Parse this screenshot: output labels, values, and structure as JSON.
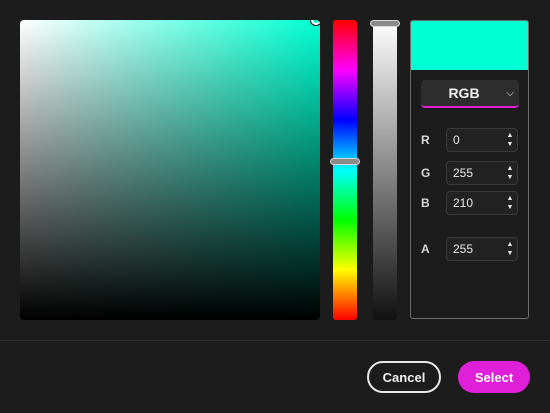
{
  "color": {
    "hue_hex": "#00ffd2",
    "preview_hex": "#00ffd2",
    "hue_level": 0.47,
    "alpha_level": 0.0
  },
  "mode": {
    "selected": "RGB",
    "chevron": "⌄"
  },
  "channels": [
    {
      "label": "R",
      "value": "0"
    },
    {
      "label": "G",
      "value": "255"
    },
    {
      "label": "B",
      "value": "210"
    },
    {
      "label": "A",
      "value": "255"
    }
  ],
  "spinner": {
    "up": "▲",
    "down": "▼"
  },
  "buttons": {
    "cancel": "Cancel",
    "select": "Select"
  },
  "accent": "#e020d8"
}
